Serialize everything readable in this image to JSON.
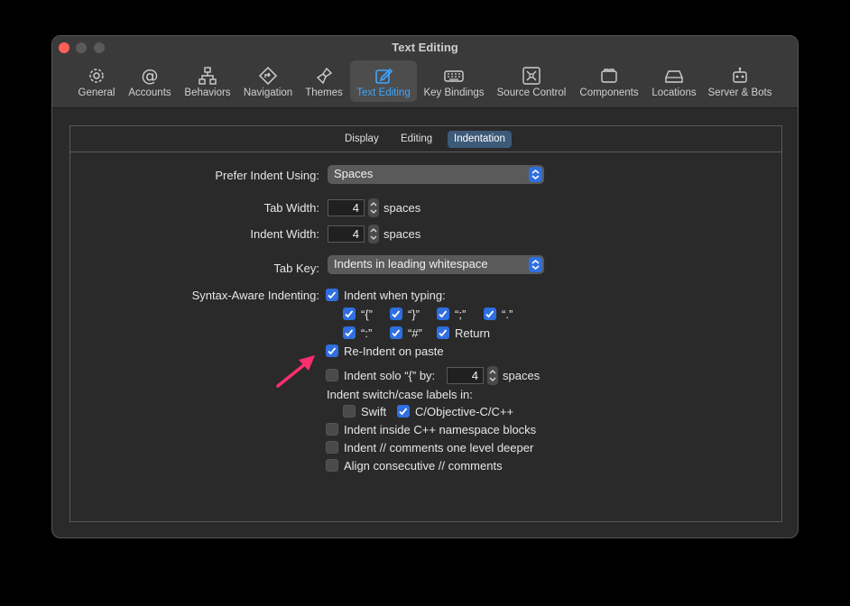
{
  "window": {
    "title": "Text Editing"
  },
  "toolbar": {
    "items": [
      {
        "label": "General",
        "icon": "gear-icon"
      },
      {
        "label": "Accounts",
        "icon": "at-icon"
      },
      {
        "label": "Behaviors",
        "icon": "hierarchy-icon"
      },
      {
        "label": "Navigation",
        "icon": "navigation-icon"
      },
      {
        "label": "Themes",
        "icon": "brush-icon"
      },
      {
        "label": "Text Editing",
        "icon": "edit-icon",
        "active": true
      },
      {
        "label": "Key Bindings",
        "icon": "keyboard-icon"
      },
      {
        "label": "Source Control",
        "icon": "source-control-icon"
      },
      {
        "label": "Components",
        "icon": "components-icon"
      },
      {
        "label": "Locations",
        "icon": "drive-icon"
      },
      {
        "label": "Server & Bots",
        "icon": "robot-icon"
      }
    ]
  },
  "tabs": [
    {
      "label": "Display"
    },
    {
      "label": "Editing"
    },
    {
      "label": "Indentation",
      "active": true
    }
  ],
  "form": {
    "prefer_indent_label": "Prefer Indent Using:",
    "prefer_indent_value": "Spaces",
    "tab_width_label": "Tab Width:",
    "tab_width_value": "4",
    "indent_width_label": "Indent Width:",
    "indent_width_value": "4",
    "spaces_unit": "spaces",
    "tab_key_label": "Tab Key:",
    "tab_key_value": "Indents in leading whitespace",
    "syntax_label": "Syntax-Aware Indenting:",
    "indent_when_typing": "Indent when typing:",
    "chars_row1": [
      "“{”",
      "“}”",
      "“;”",
      "“.”"
    ],
    "chars_row2": [
      "“:”",
      "“#”",
      "Return"
    ],
    "reindent_paste": "Re-Indent on paste",
    "indent_solo": "Indent solo “{” by:",
    "indent_solo_value": "4",
    "switch_case_label": "Indent switch/case labels in:",
    "swift": "Swift",
    "objc": "C/Objective-C/C++",
    "cpp_namespace": "Indent inside C++ namespace blocks",
    "comments_deeper": "Indent // comments one level deeper",
    "align_comments": "Align consecutive // comments"
  },
  "colors": {
    "accent": "#2f6fe0",
    "active_tab_text": "#3ea6ff",
    "annotation_arrow": "#ff2e6e"
  }
}
